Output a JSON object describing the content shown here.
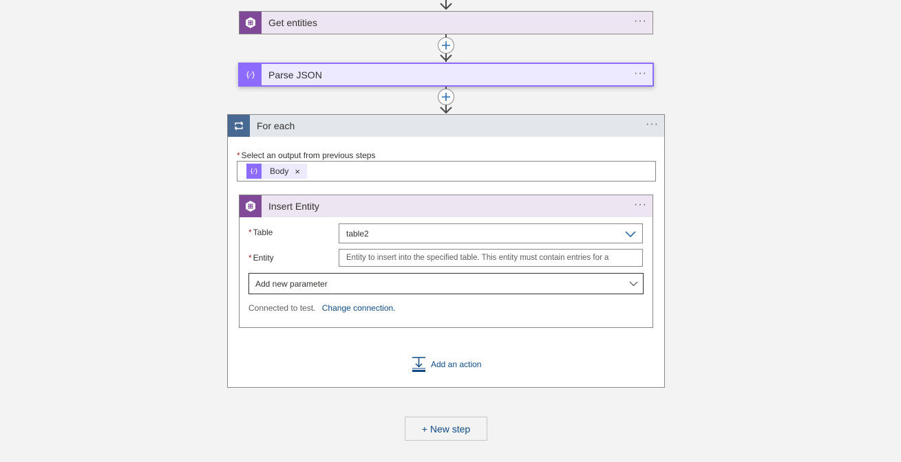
{
  "steps": {
    "get_entities": {
      "title": "Get entities",
      "icon": "table-storage-icon",
      "color": "#804998"
    },
    "parse_json": {
      "title": "Parse JSON",
      "icon": "parse-json-icon",
      "color": "#8c6cff"
    },
    "for_each": {
      "title": "For each",
      "icon": "loop-icon",
      "color": "#486991",
      "select_label": "Select an output from previous steps",
      "select_required": "*",
      "token_label": "Body",
      "token_remove": "×",
      "add_action_label": "Add an action"
    },
    "insert_entity": {
      "title": "Insert Entity",
      "icon": "table-storage-icon",
      "table_label": "Table",
      "table_required": "*",
      "table_value": "table2",
      "entity_label": "Entity",
      "entity_required": "*",
      "entity_placeholder": "Entity to insert into the specified table. This entity must contain entries for a",
      "add_param_label": "Add new parameter",
      "connected_text": "Connected to test.",
      "change_connection": "Change connection."
    }
  },
  "more_label": "···",
  "new_step_label": "+ New step"
}
